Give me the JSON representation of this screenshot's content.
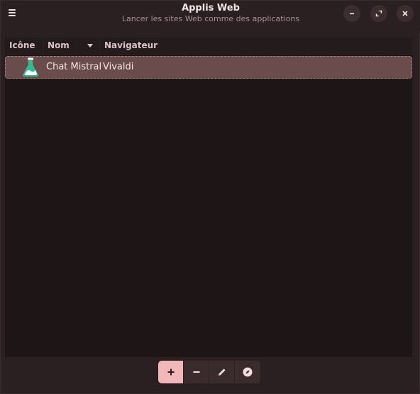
{
  "window": {
    "title": "Applis Web",
    "subtitle": "Lancer les sites Web comme des applications"
  },
  "header_buttons": {
    "menu": "hamburger-menu-icon",
    "minimize": "minimize-icon",
    "maximize": "maximize-icon",
    "close": "close-icon"
  },
  "table": {
    "columns": [
      {
        "label": "Icône"
      },
      {
        "label": "Nom",
        "sort": "descending"
      },
      {
        "label": "Navigateur"
      }
    ],
    "rows": [
      {
        "icon": "flask-icon",
        "name": "Chat Mistral",
        "browser": "Vivaldi",
        "selected": true
      }
    ]
  },
  "toolbar": {
    "buttons": [
      {
        "icon": "plus-icon",
        "active": true
      },
      {
        "icon": "minus-icon",
        "active": false
      },
      {
        "icon": "pencil-icon",
        "active": false
      },
      {
        "icon": "compass-icon",
        "active": false
      }
    ]
  },
  "colors": {
    "accent": "#f2b8b8",
    "selection": "#6b4c4d",
    "icon_green": "#2fbf8f"
  }
}
